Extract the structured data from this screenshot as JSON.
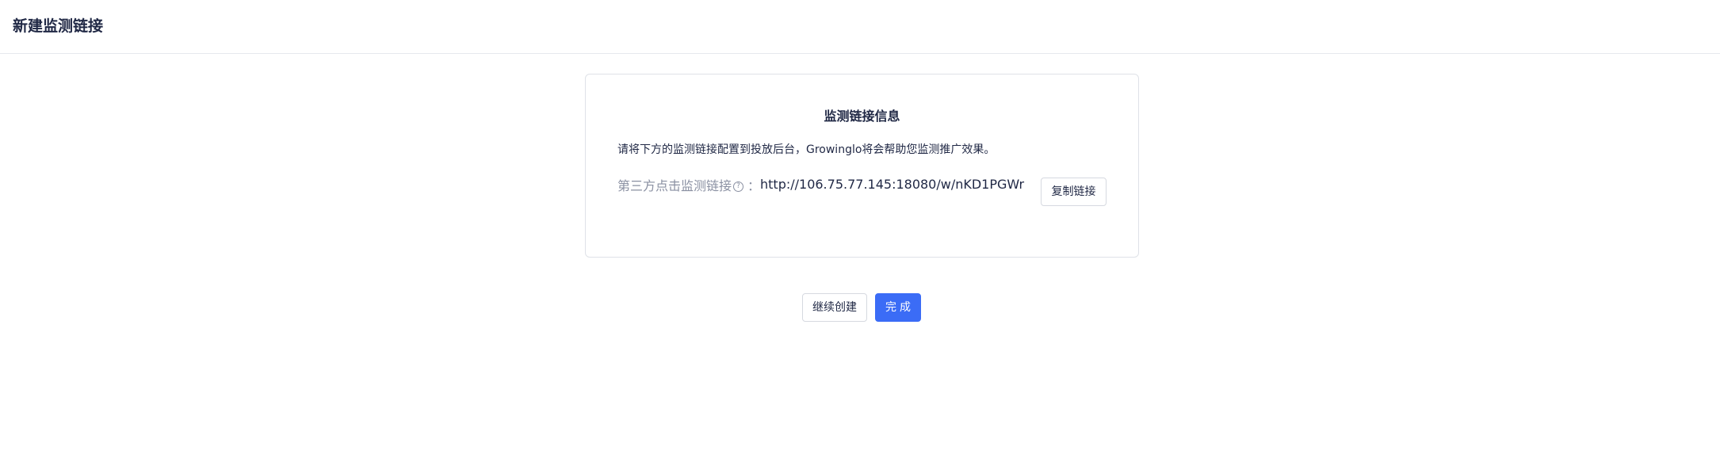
{
  "header": {
    "title": "新建监测链接"
  },
  "card": {
    "title": "监测链接信息",
    "instruction": "请将下方的监测链接配置到投放后台，Growinglo将会帮助您监测推广效果。",
    "link_label": "第三方点击监测链接",
    "help_glyph": "?",
    "colon": "：",
    "link_value": "http://106.75.77.145:18080/w/nKD1PGWr",
    "copy_label": "复制链接"
  },
  "actions": {
    "continue_label": "继续创建",
    "done_label": "完成"
  },
  "colors": {
    "primary": "#3b6cf6",
    "text": "#1f2744",
    "muted": "#8a90a2",
    "border": "#dfe2e8"
  }
}
